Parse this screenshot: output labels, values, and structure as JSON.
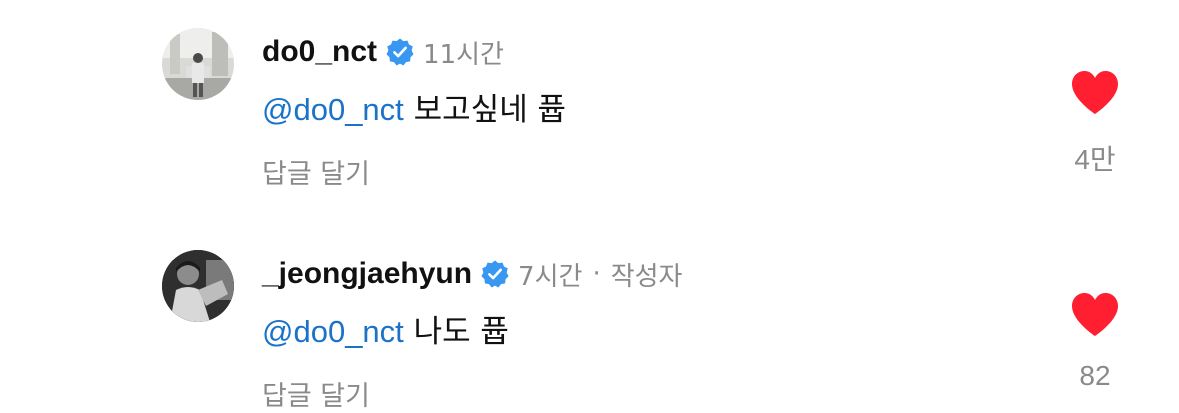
{
  "comments": [
    {
      "username": "do0_nct",
      "time": "11시간",
      "mention": "@do0_nct",
      "text": " 보고싶네 퓹",
      "reply_label": "답글 달기",
      "likes": "4만",
      "author_tag": ""
    },
    {
      "username": "_jeongjaehyun",
      "time": "7시간",
      "separator": "·",
      "author_tag": "작성자",
      "mention": "@do0_nct",
      "text": " 나도 퓹",
      "reply_label": "답글 달기",
      "likes": "82"
    }
  ],
  "colors": {
    "heart": "#ff1f30",
    "verified": "#3897f0",
    "mention": "#1a73c8",
    "muted": "#8a8a8a"
  },
  "icons": {
    "like": "heart-icon",
    "verified": "verified-badge-icon"
  }
}
